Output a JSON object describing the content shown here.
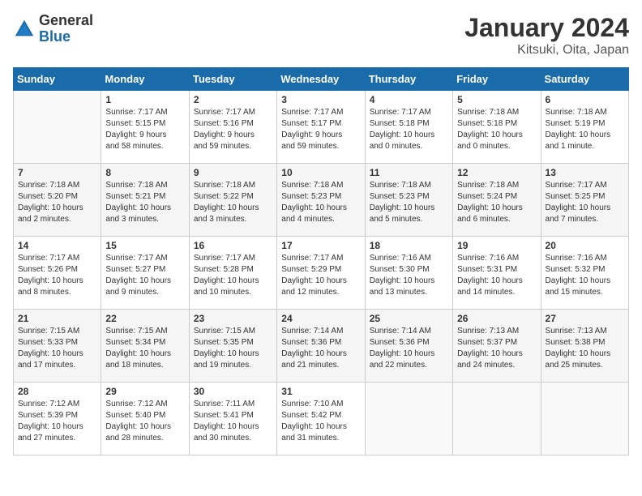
{
  "logo": {
    "general": "General",
    "blue": "Blue"
  },
  "title": "January 2024",
  "subtitle": "Kitsuki, Oita, Japan",
  "days_of_week": [
    "Sunday",
    "Monday",
    "Tuesday",
    "Wednesday",
    "Thursday",
    "Friday",
    "Saturday"
  ],
  "weeks": [
    [
      {
        "day": null,
        "info": null
      },
      {
        "day": "1",
        "info": "Sunrise: 7:17 AM\nSunset: 5:15 PM\nDaylight: 9 hours\nand 58 minutes."
      },
      {
        "day": "2",
        "info": "Sunrise: 7:17 AM\nSunset: 5:16 PM\nDaylight: 9 hours\nand 59 minutes."
      },
      {
        "day": "3",
        "info": "Sunrise: 7:17 AM\nSunset: 5:17 PM\nDaylight: 9 hours\nand 59 minutes."
      },
      {
        "day": "4",
        "info": "Sunrise: 7:17 AM\nSunset: 5:18 PM\nDaylight: 10 hours\nand 0 minutes."
      },
      {
        "day": "5",
        "info": "Sunrise: 7:18 AM\nSunset: 5:18 PM\nDaylight: 10 hours\nand 0 minutes."
      },
      {
        "day": "6",
        "info": "Sunrise: 7:18 AM\nSunset: 5:19 PM\nDaylight: 10 hours\nand 1 minute."
      }
    ],
    [
      {
        "day": "7",
        "info": "Sunrise: 7:18 AM\nSunset: 5:20 PM\nDaylight: 10 hours\nand 2 minutes."
      },
      {
        "day": "8",
        "info": "Sunrise: 7:18 AM\nSunset: 5:21 PM\nDaylight: 10 hours\nand 3 minutes."
      },
      {
        "day": "9",
        "info": "Sunrise: 7:18 AM\nSunset: 5:22 PM\nDaylight: 10 hours\nand 3 minutes."
      },
      {
        "day": "10",
        "info": "Sunrise: 7:18 AM\nSunset: 5:23 PM\nDaylight: 10 hours\nand 4 minutes."
      },
      {
        "day": "11",
        "info": "Sunrise: 7:18 AM\nSunset: 5:23 PM\nDaylight: 10 hours\nand 5 minutes."
      },
      {
        "day": "12",
        "info": "Sunrise: 7:18 AM\nSunset: 5:24 PM\nDaylight: 10 hours\nand 6 minutes."
      },
      {
        "day": "13",
        "info": "Sunrise: 7:17 AM\nSunset: 5:25 PM\nDaylight: 10 hours\nand 7 minutes."
      }
    ],
    [
      {
        "day": "14",
        "info": "Sunrise: 7:17 AM\nSunset: 5:26 PM\nDaylight: 10 hours\nand 8 minutes."
      },
      {
        "day": "15",
        "info": "Sunrise: 7:17 AM\nSunset: 5:27 PM\nDaylight: 10 hours\nand 9 minutes."
      },
      {
        "day": "16",
        "info": "Sunrise: 7:17 AM\nSunset: 5:28 PM\nDaylight: 10 hours\nand 10 minutes."
      },
      {
        "day": "17",
        "info": "Sunrise: 7:17 AM\nSunset: 5:29 PM\nDaylight: 10 hours\nand 12 minutes."
      },
      {
        "day": "18",
        "info": "Sunrise: 7:16 AM\nSunset: 5:30 PM\nDaylight: 10 hours\nand 13 minutes."
      },
      {
        "day": "19",
        "info": "Sunrise: 7:16 AM\nSunset: 5:31 PM\nDaylight: 10 hours\nand 14 minutes."
      },
      {
        "day": "20",
        "info": "Sunrise: 7:16 AM\nSunset: 5:32 PM\nDaylight: 10 hours\nand 15 minutes."
      }
    ],
    [
      {
        "day": "21",
        "info": "Sunrise: 7:15 AM\nSunset: 5:33 PM\nDaylight: 10 hours\nand 17 minutes."
      },
      {
        "day": "22",
        "info": "Sunrise: 7:15 AM\nSunset: 5:34 PM\nDaylight: 10 hours\nand 18 minutes."
      },
      {
        "day": "23",
        "info": "Sunrise: 7:15 AM\nSunset: 5:35 PM\nDaylight: 10 hours\nand 19 minutes."
      },
      {
        "day": "24",
        "info": "Sunrise: 7:14 AM\nSunset: 5:36 PM\nDaylight: 10 hours\nand 21 minutes."
      },
      {
        "day": "25",
        "info": "Sunrise: 7:14 AM\nSunset: 5:36 PM\nDaylight: 10 hours\nand 22 minutes."
      },
      {
        "day": "26",
        "info": "Sunrise: 7:13 AM\nSunset: 5:37 PM\nDaylight: 10 hours\nand 24 minutes."
      },
      {
        "day": "27",
        "info": "Sunrise: 7:13 AM\nSunset: 5:38 PM\nDaylight: 10 hours\nand 25 minutes."
      }
    ],
    [
      {
        "day": "28",
        "info": "Sunrise: 7:12 AM\nSunset: 5:39 PM\nDaylight: 10 hours\nand 27 minutes."
      },
      {
        "day": "29",
        "info": "Sunrise: 7:12 AM\nSunset: 5:40 PM\nDaylight: 10 hours\nand 28 minutes."
      },
      {
        "day": "30",
        "info": "Sunrise: 7:11 AM\nSunset: 5:41 PM\nDaylight: 10 hours\nand 30 minutes."
      },
      {
        "day": "31",
        "info": "Sunrise: 7:10 AM\nSunset: 5:42 PM\nDaylight: 10 hours\nand 31 minutes."
      },
      {
        "day": null,
        "info": null
      },
      {
        "day": null,
        "info": null
      },
      {
        "day": null,
        "info": null
      }
    ]
  ]
}
